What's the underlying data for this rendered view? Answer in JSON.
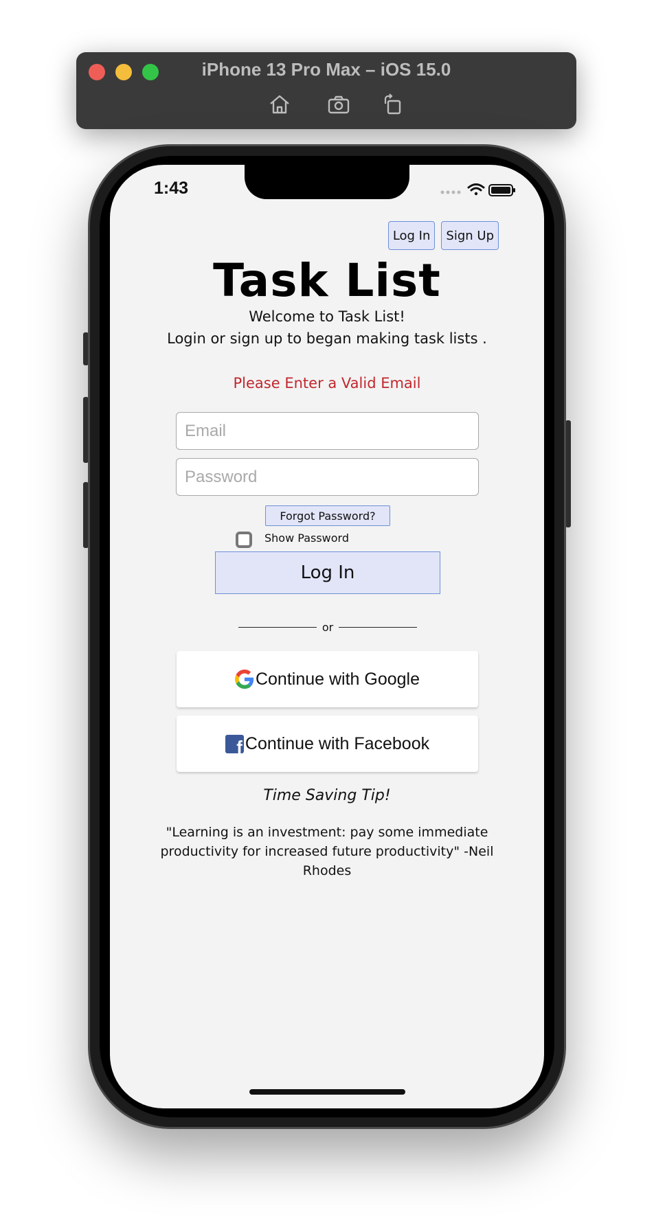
{
  "simulator": {
    "title": "iPhone 13 Pro Max – iOS 15.0",
    "toolbar": [
      "home-icon",
      "screenshot-icon",
      "rotate-icon"
    ]
  },
  "status_bar": {
    "time": "1:43",
    "icons": [
      "signal-icon",
      "wifi-icon",
      "battery-icon"
    ]
  },
  "nav": {
    "login_label": "Log In",
    "signup_label": "Sign Up"
  },
  "app": {
    "title": "Task List",
    "welcome": "Welcome to Task List!",
    "tagline": "Login or sign up to began making task lists .",
    "error": "Please Enter a Valid Email",
    "error_color": "#c1272d"
  },
  "form": {
    "email_placeholder": "Email",
    "email_value": "",
    "password_placeholder": "Password",
    "password_value": "",
    "forgot_label": "Forgot Password?",
    "show_password_label": "Show Password",
    "show_password_checked": false,
    "login_label": "Log In",
    "button_color": "#e2e5f8",
    "button_border": "#6c8fd8"
  },
  "divider": {
    "text": "or"
  },
  "social": {
    "google_label": "Continue with Google",
    "facebook_label": "Continue with Facebook",
    "facebook_glyph": "f"
  },
  "tip": {
    "title": "Time Saving Tip!",
    "quote": "\"Learning is an investment: pay some immediate productivity for increased future productivity\" -Neil Rhodes"
  }
}
